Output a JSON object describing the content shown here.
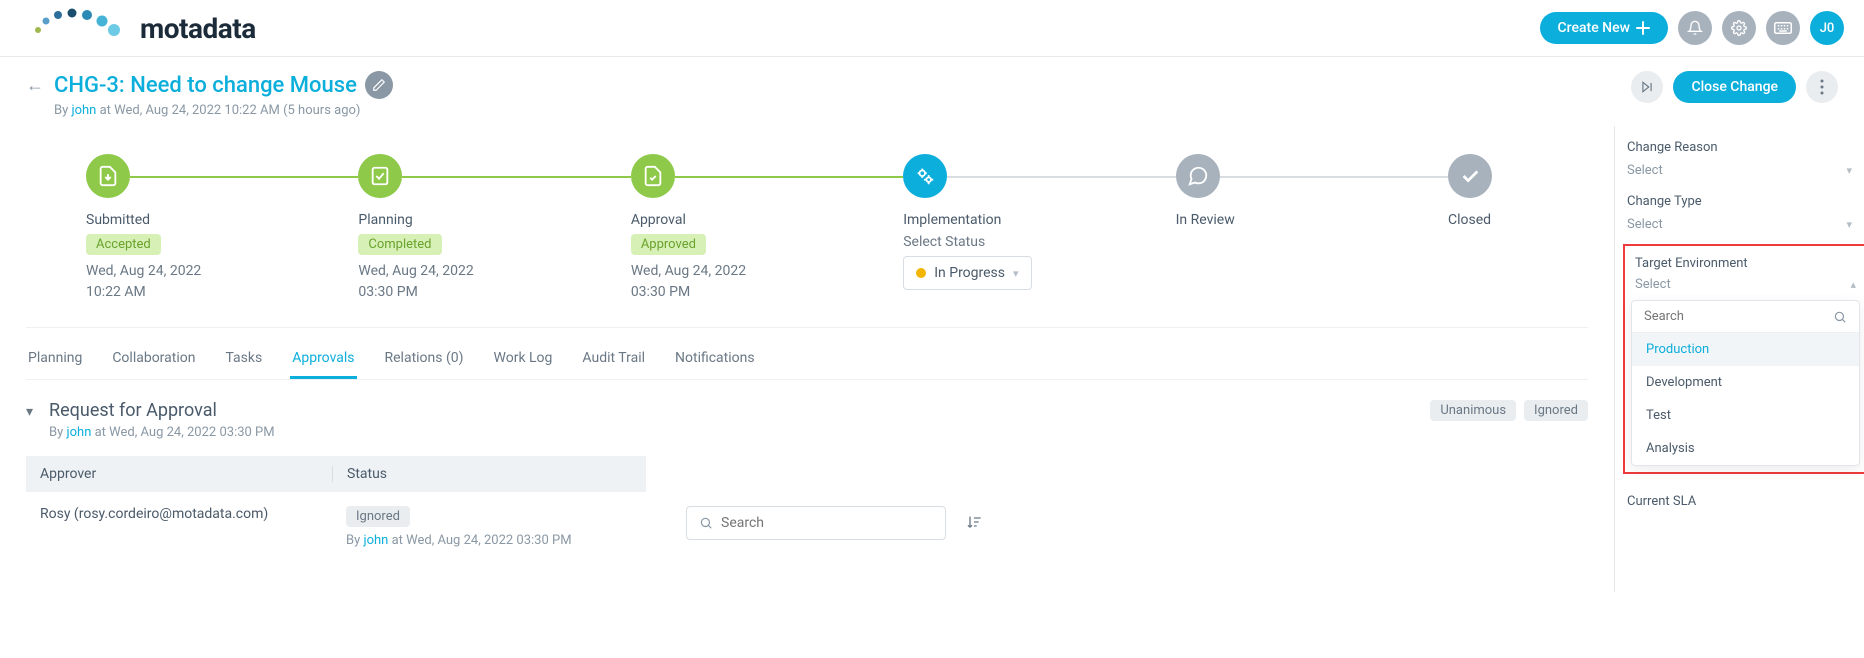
{
  "header": {
    "logo_text": "motadata",
    "create_new": "Create New",
    "avatar": "J0"
  },
  "title": {
    "heading": "CHG-3: Need to change Mouse",
    "by_prefix": "By ",
    "by_user": "john",
    "by_suffix": " at Wed, Aug 24, 2022 10:22 AM (5 hours ago)",
    "close_button": "Close Change"
  },
  "stages": [
    {
      "name": "Submitted",
      "status_badge": "Accepted",
      "date_line1": "Wed, Aug 24, 2022",
      "date_line2": "10:22 AM"
    },
    {
      "name": "Planning",
      "status_badge": "Completed",
      "date_line1": "Wed, Aug 24, 2022",
      "date_line2": "03:30 PM"
    },
    {
      "name": "Approval",
      "status_badge": "Approved",
      "date_line1": "Wed, Aug 24, 2022",
      "date_line2": "03:30 PM"
    },
    {
      "name": "Implementation",
      "sub_label": "Select Status",
      "status_value": "In Progress"
    },
    {
      "name": "In Review"
    },
    {
      "name": "Closed"
    }
  ],
  "tabs": [
    {
      "label": "Planning"
    },
    {
      "label": "Collaboration"
    },
    {
      "label": "Tasks"
    },
    {
      "label": "Approvals"
    },
    {
      "label": "Relations (0)"
    },
    {
      "label": "Work Log"
    },
    {
      "label": "Audit Trail"
    },
    {
      "label": "Notifications"
    }
  ],
  "approvals": {
    "title": "Request for Approval",
    "by_prefix": "By ",
    "by_user": "john",
    "by_suffix": " at Wed, Aug 24, 2022 03:30 PM",
    "badges": [
      "Unanimous",
      "Ignored"
    ],
    "columns": {
      "approver": "Approver",
      "status": "Status"
    },
    "rows": [
      {
        "approver": "Rosy (rosy.cordeiro@motadata.com)",
        "status_badge": "Ignored",
        "status_by_prefix": "By ",
        "status_by_user": "john",
        "status_by_suffix": " at Wed, Aug 24, 2022 03:30 PM"
      }
    ],
    "search_placeholder": "Search"
  },
  "sidebar": {
    "change_reason": {
      "label": "Change Reason",
      "value": "Select"
    },
    "change_type": {
      "label": "Change Type",
      "value": "Select"
    },
    "target_env": {
      "label": "Target Environment",
      "value": "Select",
      "search_placeholder": "Search",
      "options": [
        "Production",
        "Development",
        "Test",
        "Analysis"
      ]
    },
    "current_sla": "Current SLA"
  }
}
